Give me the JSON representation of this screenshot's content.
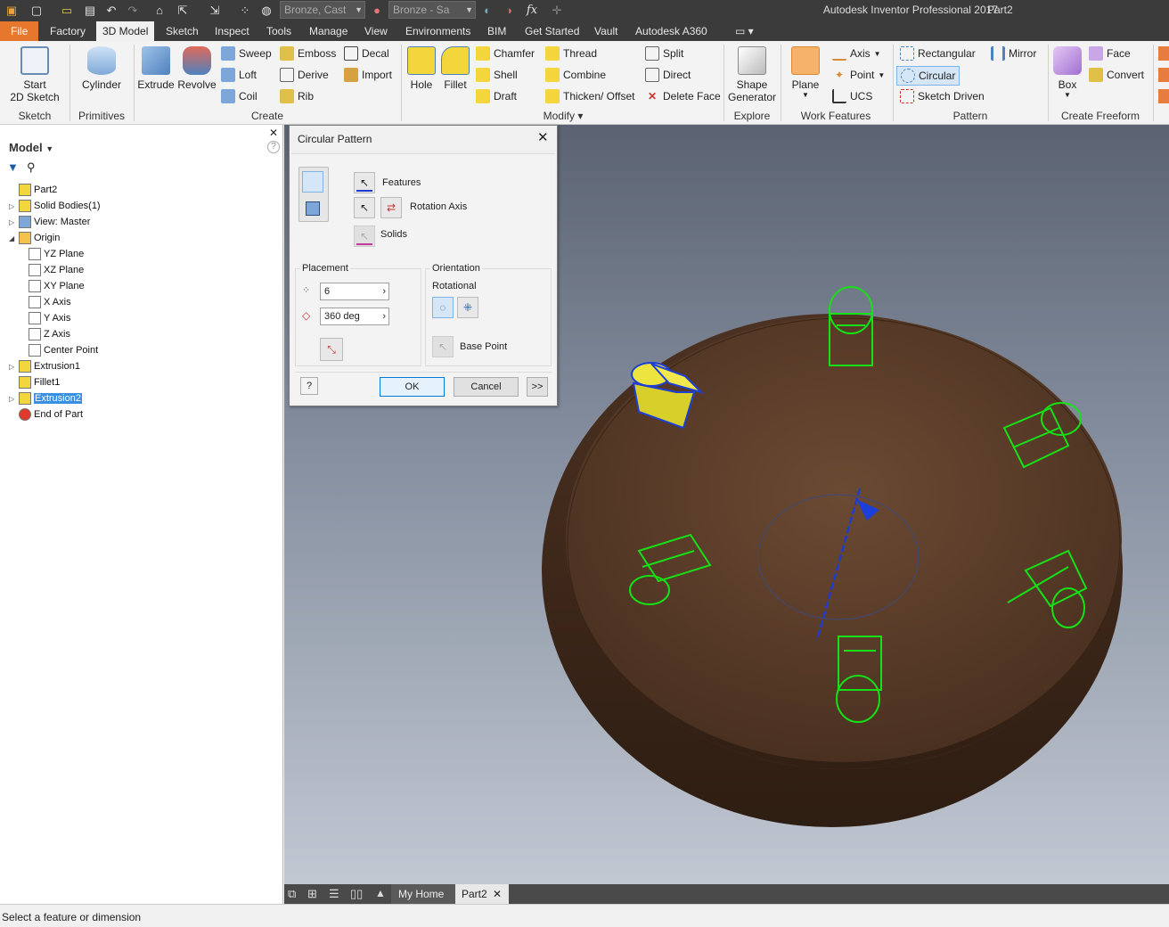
{
  "qat": {
    "material": "Bronze, Cast",
    "appearance": "Bronze - Sa",
    "fx": "fx",
    "app_title": "Autodesk Inventor Professional 2017",
    "doc_title": "Part2"
  },
  "tabs": [
    "File",
    "Factory",
    "3D Model",
    "Sketch",
    "Inspect",
    "Tools",
    "Manage",
    "View",
    "Environments",
    "BIM",
    "Get Started",
    "Vault",
    "Autodesk A360"
  ],
  "ribbon": {
    "sketch": {
      "start": "Start",
      "sketch2d": "2D Sketch",
      "group": "Sketch"
    },
    "primitives": {
      "cylinder": "Cylinder",
      "group": "Primitives"
    },
    "create": {
      "extrude": "Extrude",
      "revolve": "Revolve",
      "sweep": "Sweep",
      "loft": "Loft",
      "coil": "Coil",
      "emboss": "Emboss",
      "derive": "Derive",
      "rib": "Rib",
      "decal": "Decal",
      "import": "Import",
      "group": "Create"
    },
    "modify": {
      "hole": "Hole",
      "fillet": "Fillet",
      "chamfer": "Chamfer",
      "shell": "Shell",
      "draft": "Draft",
      "thread": "Thread",
      "combine": "Combine",
      "thicken": "Thicken/ Offset",
      "split": "Split",
      "direct": "Direct",
      "delete_face": "Delete Face",
      "group": "Modify"
    },
    "explore": {
      "shape": "Shape",
      "generator": "Generator",
      "group": "Explore"
    },
    "work": {
      "plane": "Plane",
      "axis": "Axis",
      "point": "Point",
      "ucs": "UCS",
      "group": "Work Features"
    },
    "pattern": {
      "rectangular": "Rectangular",
      "circular": "Circular",
      "sketch_driven": "Sketch Driven",
      "mirror": "Mirror",
      "group": "Pattern"
    },
    "freeform": {
      "box": "Box",
      "face": "Face",
      "convert": "Convert",
      "group": "Create Freeform"
    }
  },
  "browser": {
    "title": "Model",
    "items": [
      {
        "label": "Part2",
        "level": 0,
        "expander": ""
      },
      {
        "label": "Solid Bodies(1)",
        "level": 0,
        "expander": "▷"
      },
      {
        "label": "View: Master",
        "level": 0,
        "expander": "▷"
      },
      {
        "label": "Origin",
        "level": 0,
        "expander": "◢"
      },
      {
        "label": "YZ Plane",
        "level": 1,
        "expander": ""
      },
      {
        "label": "XZ Plane",
        "level": 1,
        "expander": ""
      },
      {
        "label": "XY Plane",
        "level": 1,
        "expander": ""
      },
      {
        "label": "X Axis",
        "level": 1,
        "expander": ""
      },
      {
        "label": "Y Axis",
        "level": 1,
        "expander": ""
      },
      {
        "label": "Z Axis",
        "level": 1,
        "expander": ""
      },
      {
        "label": "Center Point",
        "level": 1,
        "expander": ""
      },
      {
        "label": "Extrusion1",
        "level": 0,
        "expander": "▷"
      },
      {
        "label": "Fillet1",
        "level": 0,
        "expander": ""
      },
      {
        "label": "Extrusion2",
        "level": 0,
        "expander": "▷",
        "selected": true
      },
      {
        "label": "End of Part",
        "level": 0,
        "expander": ""
      }
    ]
  },
  "dialog": {
    "title": "Circular Pattern",
    "features": "Features",
    "rotation_axis": "Rotation Axis",
    "solids": "Solids",
    "placement": "Placement",
    "count": "6",
    "angle": "360 deg",
    "orientation": "Orientation",
    "rotational": "Rotational",
    "base_point": "Base Point",
    "ok": "OK",
    "cancel": "Cancel",
    "more": ">>",
    "help": "?"
  },
  "doc_tabs": {
    "home": "My Home",
    "part": "Part2"
  },
  "status": "Select a feature or dimension"
}
